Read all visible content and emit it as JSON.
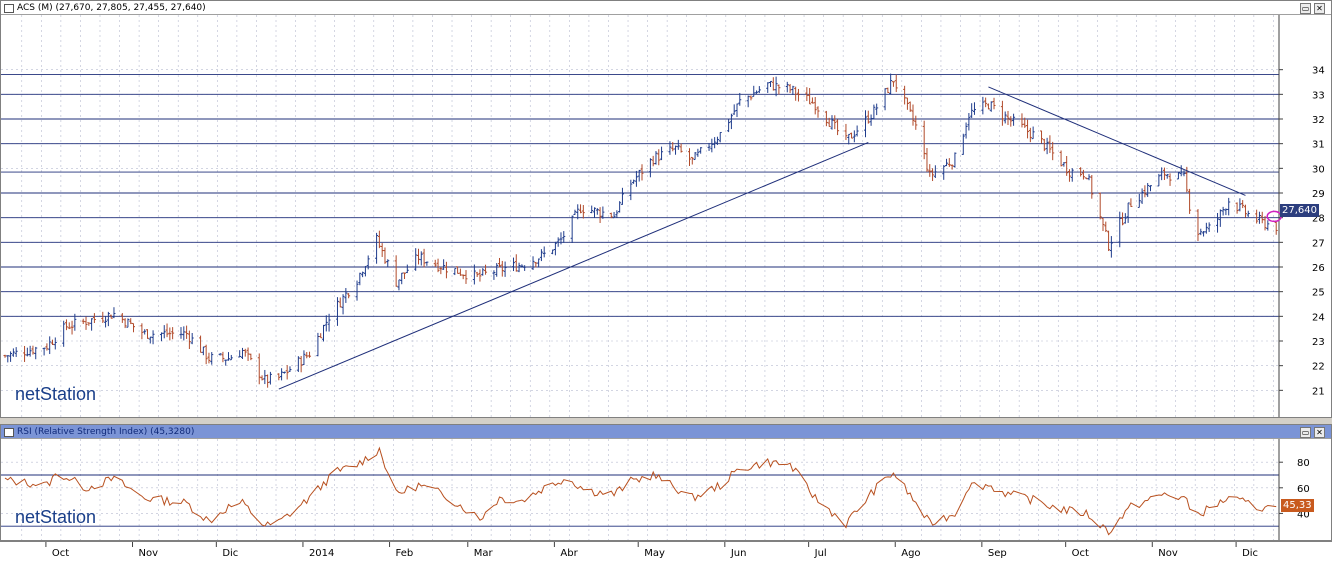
{
  "price_panel": {
    "title": "ACS (M) (27,670, 27,805, 27,455, 27,640)",
    "last_value": "27,640",
    "logo": "netStation",
    "button_restore": "▭",
    "button_close": "✕"
  },
  "rsi_panel": {
    "title": "RSI (Relative Strength Index) (45,3280)",
    "last_value": "45,33",
    "logo": "netStation",
    "button_restore": "▭",
    "button_close": "✕"
  },
  "colors": {
    "bar_up": "#1f3c8c",
    "bar_down": "#b14a2a",
    "grid": "#b8bcd0",
    "hline": "#1f2f7a",
    "rsi_line": "#b8501f",
    "last_badge_price": "#2c3e7e",
    "last_badge_rsi": "#c85a1e",
    "marker": "#d020c0"
  },
  "chart_data": [
    {
      "type": "ohlc",
      "ylim": [
        20,
        35
      ],
      "yticks": [
        21,
        22,
        23,
        24,
        25,
        26,
        27,
        28,
        29,
        30,
        31,
        32,
        33,
        34
      ],
      "horizontal_lines": [
        24,
        25,
        26,
        27,
        28,
        29,
        29.85,
        31,
        32,
        33,
        33.8
      ],
      "x_start": "2013-09-16",
      "x_end": "2014-12-16",
      "month_ticks": [
        {
          "date": "2013-10-01",
          "label": "Oct"
        },
        {
          "date": "2013-11-01",
          "label": "Nov"
        },
        {
          "date": "2013-12-01",
          "label": "Dic"
        },
        {
          "date": "2014-01-01",
          "label": "2014"
        },
        {
          "date": "2014-02-01",
          "label": "Feb"
        },
        {
          "date": "2014-03-01",
          "label": "Mar"
        },
        {
          "date": "2014-04-01",
          "label": "Abr"
        },
        {
          "date": "2014-05-01",
          "label": "May"
        },
        {
          "date": "2014-06-01",
          "label": "Jun"
        },
        {
          "date": "2014-07-01",
          "label": "Jul"
        },
        {
          "date": "2014-08-01",
          "label": "Ago"
        },
        {
          "date": "2014-09-01",
          "label": "Sep"
        },
        {
          "date": "2014-10-01",
          "label": "Oct"
        },
        {
          "date": "2014-11-01",
          "label": "Nov"
        },
        {
          "date": "2014-12-01",
          "label": "Dic"
        }
      ],
      "price_path": [
        [
          "2013-09-16",
          22.4
        ],
        [
          "2013-10-01",
          22.8
        ],
        [
          "2013-10-08",
          23.6
        ],
        [
          "2013-10-15",
          23.8
        ],
        [
          "2013-10-25",
          24.1
        ],
        [
          "2013-11-05",
          23.3
        ],
        [
          "2013-11-20",
          23.3
        ],
        [
          "2013-11-28",
          22.3
        ],
        [
          "2013-12-05",
          22.3
        ],
        [
          "2013-12-10",
          22.6
        ],
        [
          "2013-12-18",
          21.4
        ],
        [
          "2013-12-23",
          21.5
        ],
        [
          "2014-01-03",
          22.5
        ],
        [
          "2014-01-10",
          24.0
        ],
        [
          "2014-01-20",
          25.5
        ],
        [
          "2014-01-27",
          27.1
        ],
        [
          "2014-02-03",
          25.4
        ],
        [
          "2014-02-11",
          26.4
        ],
        [
          "2014-02-20",
          26.0
        ],
        [
          "2014-03-04",
          25.6
        ],
        [
          "2014-03-12",
          25.9
        ],
        [
          "2014-03-20",
          26.1
        ],
        [
          "2014-03-28",
          26.5
        ],
        [
          "2014-04-03",
          27.1
        ],
        [
          "2014-04-10",
          28.4
        ],
        [
          "2014-04-22",
          28.1
        ],
        [
          "2014-04-28",
          29.4
        ],
        [
          "2014-05-06",
          30.4
        ],
        [
          "2014-05-14",
          30.8
        ],
        [
          "2014-05-20",
          30.3
        ],
        [
          "2014-05-30",
          31.4
        ],
        [
          "2014-06-06",
          32.7
        ],
        [
          "2014-06-16",
          33.4
        ],
        [
          "2014-06-24",
          33.2
        ],
        [
          "2014-07-03",
          32.6
        ],
        [
          "2014-07-14",
          31.1
        ],
        [
          "2014-07-24",
          32.3
        ],
        [
          "2014-07-31",
          33.6
        ],
        [
          "2014-08-08",
          31.7
        ],
        [
          "2014-08-13",
          29.7
        ],
        [
          "2014-08-22",
          30.4
        ],
        [
          "2014-08-27",
          32.2
        ],
        [
          "2014-09-03",
          32.6
        ],
        [
          "2014-09-10",
          32.0
        ],
        [
          "2014-09-20",
          31.3
        ],
        [
          "2014-09-26",
          30.6
        ],
        [
          "2014-10-02",
          29.9
        ],
        [
          "2014-10-08",
          29.8
        ],
        [
          "2014-10-16",
          26.9
        ],
        [
          "2014-10-24",
          28.6
        ],
        [
          "2014-11-05",
          29.8
        ],
        [
          "2014-11-12",
          29.6
        ],
        [
          "2014-11-16",
          27.4
        ],
        [
          "2014-11-22",
          27.6
        ],
        [
          "2014-11-28",
          28.7
        ],
        [
          "2014-12-04",
          28.2
        ],
        [
          "2014-12-10",
          27.8
        ],
        [
          "2014-12-15",
          27.64
        ]
      ],
      "trendlines": [
        {
          "from": [
            "2013-12-23",
            21.05
          ],
          "to": [
            "2014-07-22",
            31.05
          ]
        },
        {
          "from": [
            "2014-09-03",
            33.3
          ],
          "to": [
            "2014-12-04",
            28.9
          ]
        }
      ]
    },
    {
      "type": "line",
      "ylim": [
        20,
        95
      ],
      "yticks": [
        40,
        60,
        80
      ],
      "horizontal_lines": [
        30,
        70
      ],
      "rsi_path": [
        [
          "2013-09-16",
          66
        ],
        [
          "2013-10-01",
          62
        ],
        [
          "2013-10-05",
          72
        ],
        [
          "2013-10-15",
          60
        ],
        [
          "2013-10-25",
          67
        ],
        [
          "2013-11-05",
          52
        ],
        [
          "2013-11-20",
          48
        ],
        [
          "2013-11-28",
          34
        ],
        [
          "2013-12-05",
          45
        ],
        [
          "2013-12-10",
          48
        ],
        [
          "2013-12-18",
          30
        ],
        [
          "2013-12-23",
          33
        ],
        [
          "2014-01-03",
          52
        ],
        [
          "2014-01-12",
          72
        ],
        [
          "2014-01-20",
          78
        ],
        [
          "2014-01-28",
          90
        ],
        [
          "2014-02-03",
          55
        ],
        [
          "2014-02-11",
          62
        ],
        [
          "2014-02-20",
          55
        ],
        [
          "2014-03-05",
          36
        ],
        [
          "2014-03-12",
          52
        ],
        [
          "2014-03-20",
          50
        ],
        [
          "2014-03-28",
          60
        ],
        [
          "2014-04-05",
          68
        ],
        [
          "2014-04-12",
          58
        ],
        [
          "2014-04-22",
          55
        ],
        [
          "2014-04-28",
          65
        ],
        [
          "2014-05-06",
          70
        ],
        [
          "2014-05-14",
          60
        ],
        [
          "2014-05-20",
          52
        ],
        [
          "2014-05-30",
          62
        ],
        [
          "2014-06-06",
          75
        ],
        [
          "2014-06-16",
          80
        ],
        [
          "2014-06-24",
          78
        ],
        [
          "2014-07-03",
          52
        ],
        [
          "2014-07-14",
          32
        ],
        [
          "2014-07-24",
          58
        ],
        [
          "2014-07-31",
          72
        ],
        [
          "2014-08-08",
          48
        ],
        [
          "2014-08-13",
          32
        ],
        [
          "2014-08-22",
          40
        ],
        [
          "2014-08-27",
          62
        ],
        [
          "2014-09-03",
          62
        ],
        [
          "2014-09-10",
          55
        ],
        [
          "2014-09-20",
          50
        ],
        [
          "2014-09-26",
          45
        ],
        [
          "2014-10-02",
          42
        ],
        [
          "2014-10-08",
          40
        ],
        [
          "2014-10-16",
          26
        ],
        [
          "2014-10-24",
          45
        ],
        [
          "2014-11-05",
          55
        ],
        [
          "2014-11-12",
          52
        ],
        [
          "2014-11-16",
          38
        ],
        [
          "2014-11-22",
          45
        ],
        [
          "2014-11-28",
          52
        ],
        [
          "2014-12-04",
          48
        ],
        [
          "2014-12-10",
          44
        ],
        [
          "2014-12-15",
          45.33
        ]
      ]
    }
  ]
}
